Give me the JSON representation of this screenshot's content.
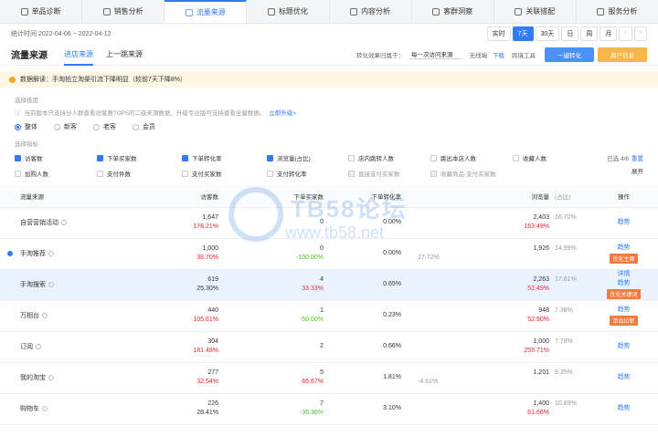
{
  "nav": [
    {
      "label": "单品诊断",
      "active": false
    },
    {
      "label": "销售分析",
      "active": false
    },
    {
      "label": "流量来源",
      "active": true
    },
    {
      "label": "标题优化",
      "active": false
    },
    {
      "label": "内容分析",
      "active": false
    },
    {
      "label": "客群洞察",
      "active": false
    },
    {
      "label": "关联搭配",
      "active": false
    },
    {
      "label": "服务分析",
      "active": false
    }
  ],
  "stats_period": "统计时间 2022-04-06 ~ 2022-04-12",
  "date_modes": [
    "实时",
    "7天",
    "30天",
    "日",
    "周",
    "月"
  ],
  "date_active": "7天",
  "section_title": "流量来源",
  "subtabs": [
    "进店来源",
    "上一跳来源"
  ],
  "conversion": {
    "label": "转化效果归属于：",
    "value": "每一次访问来源"
  },
  "terminal": "无线端",
  "download": "下载",
  "tools": "跨境工具",
  "btn_convert": "一键转化",
  "btn_user": "用户信息",
  "notice": "数据解读：手淘拍立淘渠引流下降明显（较前7天下降8%）",
  "filter_label": "选择极度",
  "upgrade_desc": "当前版本只支持分人群查看访客数TOP5的二级来源数据，升级专业版可支持查看全量数据。",
  "upgrade_link": "立即升级>",
  "crowd": [
    {
      "label": "整体",
      "on": true
    },
    {
      "label": "新客",
      "on": false
    },
    {
      "label": "老客",
      "on": false
    },
    {
      "label": "会员",
      "on": false
    }
  ],
  "metrics_label": "选择指标",
  "metrics": [
    {
      "label": "访客数",
      "state": "on"
    },
    {
      "label": "下单买家数",
      "state": "on"
    },
    {
      "label": "下单转化率",
      "state": "on"
    },
    {
      "label": "浏览量(占比)",
      "state": "on"
    },
    {
      "label": "店内跳转人数",
      "state": "off"
    },
    {
      "label": "跳出本店人数",
      "state": "off"
    },
    {
      "label": "收藏人数",
      "state": "off"
    },
    {
      "label": "加购人数",
      "state": "off"
    },
    {
      "label": "支付件数",
      "state": "off"
    },
    {
      "label": "支付买家数",
      "state": "off"
    },
    {
      "label": "支付转化率",
      "state": "off"
    },
    {
      "label": "直接支付买家数",
      "state": "dis"
    },
    {
      "label": "收藏商品-支付买家数",
      "state": "dis"
    }
  ],
  "selected_info": "已选 4/6",
  "reset": "重置",
  "collapse": "展开",
  "table": {
    "headers": [
      "流量来源",
      "访客数",
      "下单买家数",
      "下单转化率",
      "浏览量",
      "(占比)",
      "操作"
    ],
    "rows": [
      {
        "src": "自营营销活动",
        "marker": false,
        "hl": false,
        "visitors": "1,647",
        "visitors_c": "178.21%",
        "vc": "r",
        "buyers": "0",
        "buyers_c": "",
        "bc": "r",
        "rate": "0.00%",
        "rate_c": "",
        "rc": "r",
        "pv": "2,403",
        "pv_c": "163.49%",
        "pc": "r",
        "share": "16.70%",
        "ops": [
          "趋势"
        ],
        "tags": []
      },
      {
        "src": "手淘推荐",
        "marker": true,
        "hl": false,
        "visitors": "1,000",
        "visitors_c": "38.70%",
        "vc": "r",
        "buyers": "0",
        "buyers_c": "-100.00%",
        "bc": "g",
        "rate": "0.00%",
        "rate_c": "",
        "rc": "r",
        "pv": "1,926",
        "pv_c": "27.72%",
        "pc": "n",
        "share": "14.99%",
        "ops": [
          "趋势"
        ],
        "tags": [
          "优化主图"
        ]
      },
      {
        "src": "手淘搜索",
        "marker": false,
        "hl": true,
        "visitors": "619",
        "visitors_c": "25.30%",
        "vc": "n",
        "buyers": "4",
        "buyers_c": "33.33%",
        "bc": "r",
        "rate": "0.65%",
        "rate_c": "",
        "rc": "r",
        "pv": "2,263",
        "pv_c": "52.49%",
        "pc": "r",
        "share": "17.61%",
        "ops": [
          "详情",
          "趋势"
        ],
        "tags": [
          "优化关键词"
        ]
      },
      {
        "src": "万相台",
        "marker": false,
        "hl": false,
        "visitors": "440",
        "visitors_c": "105.61%",
        "vc": "r",
        "buyers": "1",
        "buyers_c": "-50.00%",
        "bc": "g",
        "rate": "0.23%",
        "rate_c": "",
        "rc": "r",
        "pv": "948",
        "pv_c": "52.90%",
        "pc": "r",
        "share": "7.38%",
        "ops": [
          "趋势"
        ],
        "tags": [
          "单品拉新"
        ]
      },
      {
        "src": "订阅",
        "marker": false,
        "hl": false,
        "visitors": "304",
        "visitors_c": "181.48%",
        "vc": "r",
        "buyers": "2",
        "buyers_c": "",
        "bc": "r",
        "rate": "0.66%",
        "rate_c": "",
        "rc": "r",
        "pv": "1,000",
        "pv_c": "259.71%",
        "pc": "r",
        "share": "7.78%",
        "ops": [
          "趋势"
        ],
        "tags": []
      },
      {
        "src": "我的淘宝",
        "marker": false,
        "hl": false,
        "visitors": "277",
        "visitors_c": "32.54%",
        "vc": "r",
        "buyers": "5",
        "buyers_c": "66.67%",
        "bc": "r",
        "rate": "1.81%",
        "rate_c": "",
        "rc": "r",
        "pv": "1,201",
        "pv_c": "-4.61%",
        "pc": "n",
        "share": "9.35%",
        "ops": [
          "趋势"
        ],
        "tags": []
      },
      {
        "src": "购物车",
        "marker": false,
        "hl": false,
        "visitors": "226",
        "visitors_c": "28.41%",
        "vc": "n",
        "buyers": "7",
        "buyers_c": "-36.36%",
        "bc": "g",
        "rate": "3.10%",
        "rate_c": "",
        "rc": "r",
        "pv": "1,400",
        "pv_c": "61.66%",
        "pc": "r",
        "share": "10.89%",
        "ops": [
          "趋势"
        ],
        "tags": []
      }
    ]
  },
  "watermark": {
    "title": "TB58论坛",
    "url": "www.tb58.net"
  }
}
